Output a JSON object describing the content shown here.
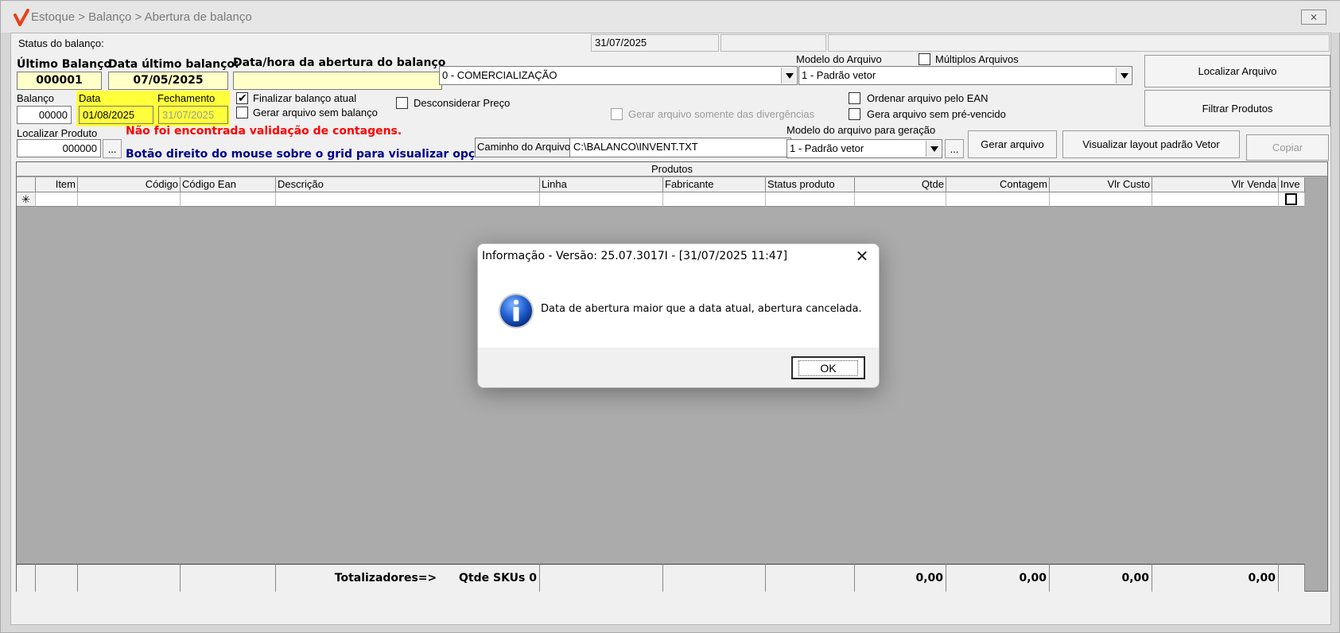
{
  "window": {
    "title": "Estoque > Balanço > Abertura de balanço",
    "close_label": "⨯"
  },
  "status": {
    "label": "Status do balanço:",
    "date": "31/07/2025",
    "box2": "",
    "box3": ""
  },
  "ultimo_balanco": {
    "label": "Último Balanço",
    "value": "000001"
  },
  "data_ultimo": {
    "label": "Data último balanço:",
    "value": "07/05/2025"
  },
  "data_abertura": {
    "label": "Data/hora da abertura do balanço",
    "value": ""
  },
  "tipo": {
    "value": "0 - COMERCIALIZAÇÃO"
  },
  "modelo_arquivo": {
    "label": "Modelo do Arquivo",
    "value": "1 - Padrão vetor"
  },
  "multiplos": {
    "label": "Múltiplos Arquivos",
    "checked": false
  },
  "balanco": {
    "label": "Balanço",
    "value": "00000"
  },
  "data": {
    "label": "Data",
    "value": "01/08/2025"
  },
  "fechamento": {
    "label": "Fechamento",
    "value": "31/07/2025"
  },
  "options": {
    "finalizar": "Finalizar balanço atual",
    "gerar_sem_balanco": "Gerar arquivo sem balanço",
    "desconsiderar": "Desconsiderar Preço",
    "divergencias": "Gerar arquivo somente das divergências",
    "ordenar_ean": "Ordenar arquivo pelo EAN",
    "pre_vencido": "Gera arquivo sem pré-vencido"
  },
  "localizar_produto": {
    "label": "Localizar Produto",
    "value": "000000",
    "browse": "..."
  },
  "warning": "Não foi encontrada validação de contagens.",
  "hint": "Botão direito do mouse sobre o grid para visualizar opções",
  "caminho": {
    "label": "Caminho do Arquivo:",
    "value": "C:\\BALANCO\\INVENT.TXT"
  },
  "modelo_geracao": {
    "label": "Modelo do arquivo para geração",
    "value": "1 - Padrão vetor",
    "browse": "..."
  },
  "buttons": {
    "localizar": "Localizar Arquivo",
    "filtrar": "Filtrar Produtos",
    "gerar": "Gerar arquivo",
    "visualizar": "Visualizar layout padrão Vetor",
    "copiar": "Copiar"
  },
  "grid": {
    "caption": "Produtos",
    "columns": [
      "",
      "Item",
      "Código",
      "Código Ean",
      "Descrição",
      "Linha",
      "Fabricante",
      "Status produto",
      "Qtde",
      "Contagem",
      "Vlr Custo",
      "Vlr Venda",
      "Inve"
    ],
    "new_row_marker": "✳",
    "footer": {
      "label": "Totalizadores=>",
      "skus": "Qtde SKUs 0",
      "qtde": "0,00",
      "contagem": "0,00",
      "custo": "0,00",
      "venda": "0,00"
    }
  },
  "dialog": {
    "title": "Informação - Versão: 25.07.3017I - [31/07/2025 11:47]",
    "close": "✕",
    "message": "Data de abertura maior que a data atual, abertura cancelada.",
    "ok": "OK"
  },
  "colors": {
    "warning": "#ff0000",
    "hint": "#00008b",
    "highlight": "#ffff3a",
    "field_yellow": "#ffffc8"
  }
}
